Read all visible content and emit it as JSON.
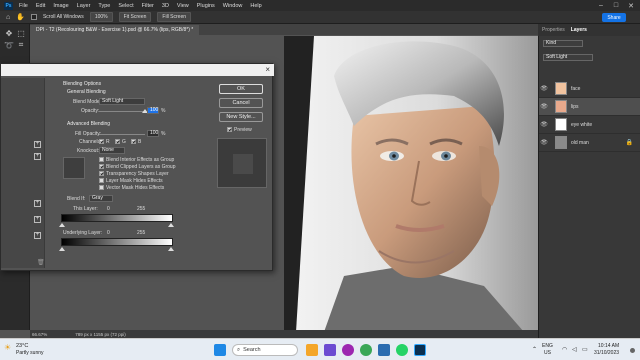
{
  "menubar": {
    "items": [
      "File",
      "Edit",
      "Image",
      "Layer",
      "Type",
      "Select",
      "Filter",
      "3D",
      "View",
      "Plugins",
      "Window",
      "Help"
    ]
  },
  "options": {
    "scroll_all": "Scroll All Windows",
    "zoom": "100%",
    "fit_screen": "Fit Screen",
    "fill_screen": "Fill Screen",
    "share": "Share"
  },
  "document": {
    "tab_title": "DPI - T2 (Recolouring B&W - Exercise 1).psd @ 66.7% (lips, RGB/8*) *",
    "zoom_status": "66.67%",
    "dimensions_status": "789 px x 1155 px (72 ppi)"
  },
  "panels": {
    "tabs": [
      "Properties",
      "Layers"
    ],
    "layers_search": "Kind",
    "blend_mode": "Soft Light",
    "layers": [
      {
        "name": "face",
        "thumb": "#f1c39f"
      },
      {
        "name": "lips",
        "thumb": "#e8a98c"
      },
      {
        "name": "eye white",
        "thumb": "#ffffff"
      },
      {
        "name": "old man",
        "thumb": "#8a8a8a"
      }
    ]
  },
  "dialog": {
    "section_title": "Blending Options",
    "general_blending": "General Blending",
    "blend_mode_label": "Blend Mode:",
    "blend_mode_value": "Soft Light",
    "opacity_label": "Opacity:",
    "opacity_value": "100",
    "opacity_fraction": 1.0,
    "percent": "%",
    "advanced_blending": "Advanced Blending",
    "fill_opacity_label": "Fill Opacity:",
    "fill_opacity_value": "100",
    "channels_label": "Channels:",
    "channel_r": "R",
    "channel_g": "G",
    "channel_b": "B",
    "knockout_label": "Knockout:",
    "knockout_value": "None",
    "options": [
      {
        "label": "Blend Interior Effects as Group",
        "checked": false
      },
      {
        "label": "Blend Clipped Layers as Group",
        "checked": true
      },
      {
        "label": "Transparency Shapes Layer",
        "checked": true
      },
      {
        "label": "Layer Mask Hides Effects",
        "checked": false
      },
      {
        "label": "Vector Mask Hides Effects",
        "checked": false
      }
    ],
    "blend_if_label": "Blend If:",
    "blend_if_value": "Gray",
    "this_layer_label": "This Layer:",
    "this_layer_low": "0",
    "this_layer_high": "255",
    "underlying_label": "Underlying Layer:",
    "underlying_low": "0",
    "underlying_high": "255",
    "ok": "OK",
    "cancel": "Cancel",
    "new_style": "New Style...",
    "preview": "Preview"
  },
  "taskbar": {
    "weather_temp": "23°C",
    "weather_desc": "Partly sunny",
    "search": "Search",
    "lang_top": "ENG",
    "lang_bottom": "US",
    "time": "10:14 AM",
    "date": "31/10/2023"
  }
}
